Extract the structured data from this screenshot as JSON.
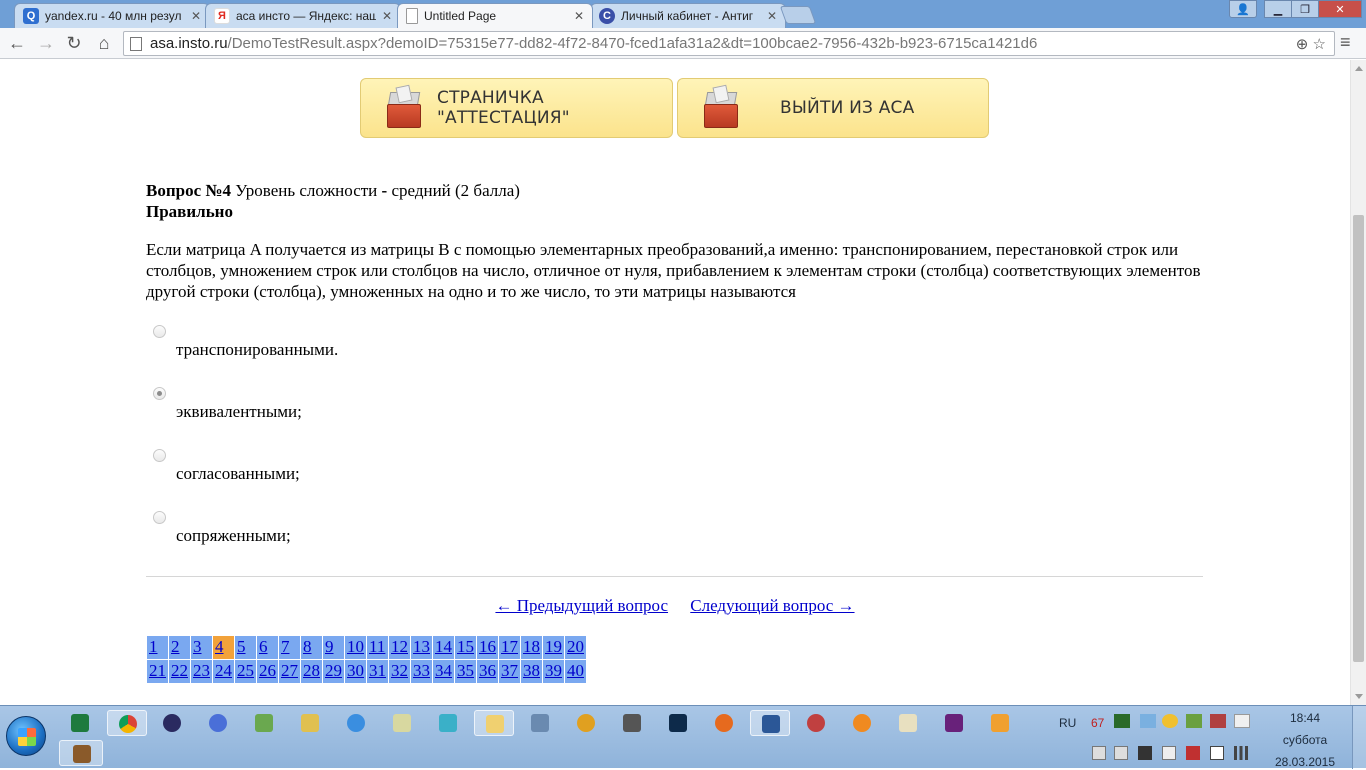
{
  "browser": {
    "tabs": [
      {
        "title": "yandex.ru - 40 млн резул",
        "icon": "search-icon",
        "color": "#2f6fd0"
      },
      {
        "title": "аса инсто — Яндекс: наш",
        "icon": "yandex-icon",
        "color": "#e02b20"
      },
      {
        "title": "Untitled Page",
        "icon": "page-icon",
        "color": "#ffffff"
      },
      {
        "title": "Личный кабинет - Антиг",
        "icon": "antiplagiat-icon",
        "color": "#3a4fa8"
      }
    ],
    "url_host": "asa.insto.ru",
    "url_rest": "/DemoTestResult.aspx?demoID=75315e77-dd82-4f72-8470-fced1afa31a2&dt=100bcae2-7956-432b-b923-6715ca1421d6"
  },
  "header_buttons": {
    "attestation": "СТРАНИЧКА \"АТТЕСТАЦИЯ\"",
    "logout": "ВЫЙТИ ИЗ АСА"
  },
  "question": {
    "number_label": "Вопрос №4",
    "difficulty_text": " Уровень сложности ",
    "difficulty_dash": "-",
    "difficulty_value": " средний (2 балла)",
    "status": "Правильно",
    "text": "Если матрица A получается из матрицы B с помощью элементарных преобразований,а именно: транспонированием, перестановкой строк или столбцов, умножением строк или столбцов на число, отличное от нуля, прибавлением к элементам строки (столбца) соответствующих элементов другой строки (столбца), умноженных на одно и то же число, то эти матрицы называются",
    "options": [
      {
        "label": "транспонированными.",
        "selected": false
      },
      {
        "label": "эквивалентными;",
        "selected": true
      },
      {
        "label": "согласованными;",
        "selected": false
      },
      {
        "label": "сопряженными;",
        "selected": false
      }
    ]
  },
  "navigation": {
    "prev": "← Предыдущий вопрос",
    "next": "Следующий вопрос →"
  },
  "question_grid": {
    "numbers": [
      "1",
      "2",
      "3",
      "4",
      "5",
      "6",
      "7",
      "8",
      "9",
      "10",
      "11",
      "12",
      "13",
      "14",
      "15",
      "16",
      "17",
      "18",
      "19",
      "20",
      "21",
      "22",
      "23",
      "24",
      "25",
      "26",
      "27",
      "28",
      "29",
      "30",
      "31",
      "32",
      "33",
      "34",
      "35",
      "36",
      "37",
      "38",
      "39",
      "40"
    ],
    "current": "4",
    "colors": {
      "default": "#7aa8f0",
      "current": "#f2a23a"
    }
  },
  "taskbar": {
    "language": "RU",
    "tray_number": "67",
    "time": "18:44",
    "day": "суббота",
    "date": "28.03.2015"
  }
}
